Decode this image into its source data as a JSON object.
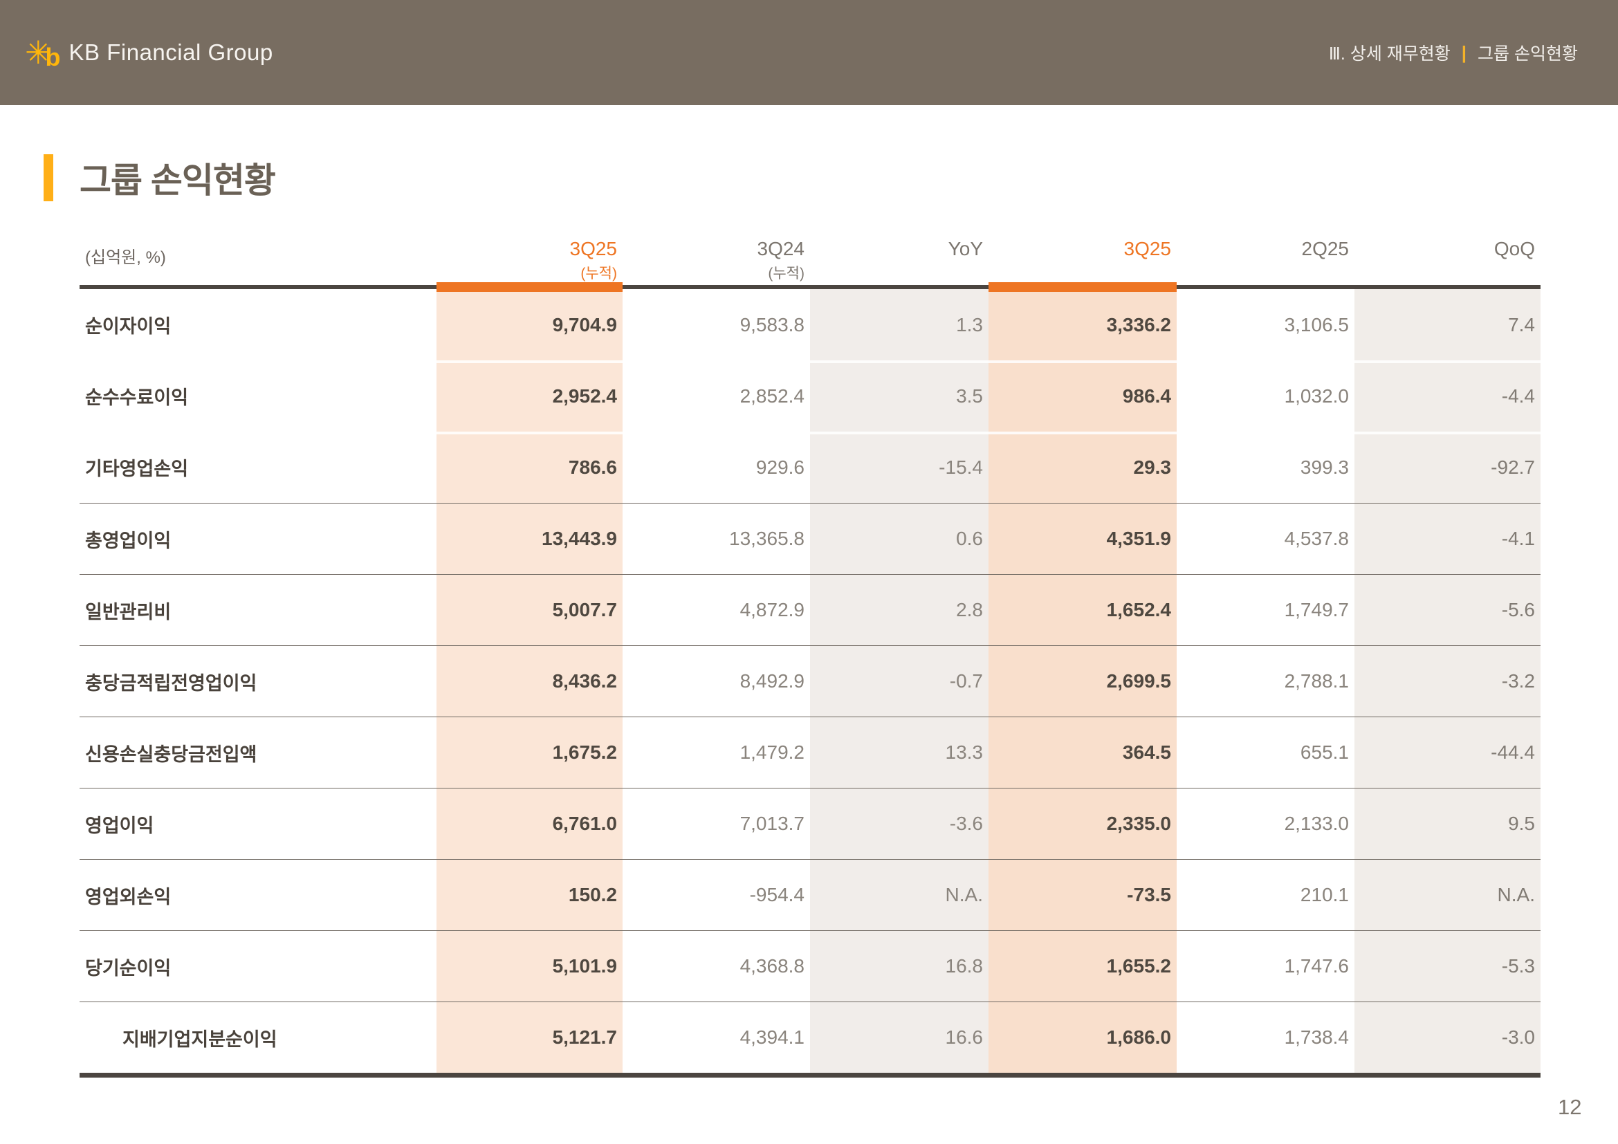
{
  "topbar": {
    "brand": "KB Financial Group",
    "breadcrumb": {
      "section": "Ⅲ. 상세 재무현황",
      "divider": "|",
      "page": "그룹 손익현황"
    }
  },
  "title": "그룹 손익현황",
  "table": {
    "unit_label": "(십억원, %)",
    "columns": [
      {
        "label": "3Q25",
        "sublabel": "(누적)",
        "highlight": true
      },
      {
        "label": "3Q24",
        "sublabel": "(누적)",
        "highlight": false
      },
      {
        "label": "YoY",
        "highlight": false
      },
      {
        "label": "3Q25",
        "highlight": true
      },
      {
        "label": "2Q25",
        "highlight": false
      },
      {
        "label": "QoQ",
        "highlight": false
      }
    ],
    "rows": [
      {
        "label": "순이자이익",
        "values": [
          "9,704.9",
          "9,583.8",
          "1.3",
          "3,336.2",
          "3,106.5",
          "7.4"
        ]
      },
      {
        "label": "순수수료이익",
        "values": [
          "2,952.4",
          "2,852.4",
          "3.5",
          "986.4",
          "1,032.0",
          "-4.4"
        ]
      },
      {
        "label": "기타영업손익",
        "values": [
          "786.6",
          "929.6",
          "-15.4",
          "29.3",
          "399.3",
          "-92.7"
        ]
      },
      {
        "label": "총영업이익",
        "values": [
          "13,443.9",
          "13,365.8",
          "0.6",
          "4,351.9",
          "4,537.8",
          "-4.1"
        ]
      },
      {
        "label": "일반관리비",
        "values": [
          "5,007.7",
          "4,872.9",
          "2.8",
          "1,652.4",
          "1,749.7",
          "-5.6"
        ]
      },
      {
        "label": "충당금적립전영업이익",
        "values": [
          "8,436.2",
          "8,492.9",
          "-0.7",
          "2,699.5",
          "2,788.1",
          "-3.2"
        ]
      },
      {
        "label": "신용손실충당금전입액",
        "values": [
          "1,675.2",
          "1,479.2",
          "13.3",
          "364.5",
          "655.1",
          "-44.4"
        ]
      },
      {
        "label": "영업이익",
        "values": [
          "6,761.0",
          "7,013.7",
          "-3.6",
          "2,335.0",
          "2,133.0",
          "9.5"
        ]
      },
      {
        "label": "영업외손익",
        "values": [
          "150.2",
          "-954.4",
          "N.A.",
          "-73.5",
          "210.1",
          "N.A."
        ]
      },
      {
        "label": "당기순이익",
        "values": [
          "5,101.9",
          "4,368.8",
          "16.8",
          "1,655.2",
          "1,747.6",
          "-5.3"
        ]
      },
      {
        "label": "지배기업지분순이익",
        "indent": true,
        "values": [
          "5,121.7",
          "4,394.1",
          "16.6",
          "1,686.0",
          "1,738.4",
          "-3.0"
        ]
      }
    ]
  },
  "page_number": "12",
  "colors": {
    "topbar_bg": "#786d61",
    "accent_orange": "#ee7523",
    "accent_yellow": "#ffaf17",
    "highlight_col_bg": "#fbe6d7",
    "highlight_col_bg_strong": "#f9dfcc",
    "neutral_col_bg": "#f1edea",
    "dark_line": "#4b4540"
  }
}
